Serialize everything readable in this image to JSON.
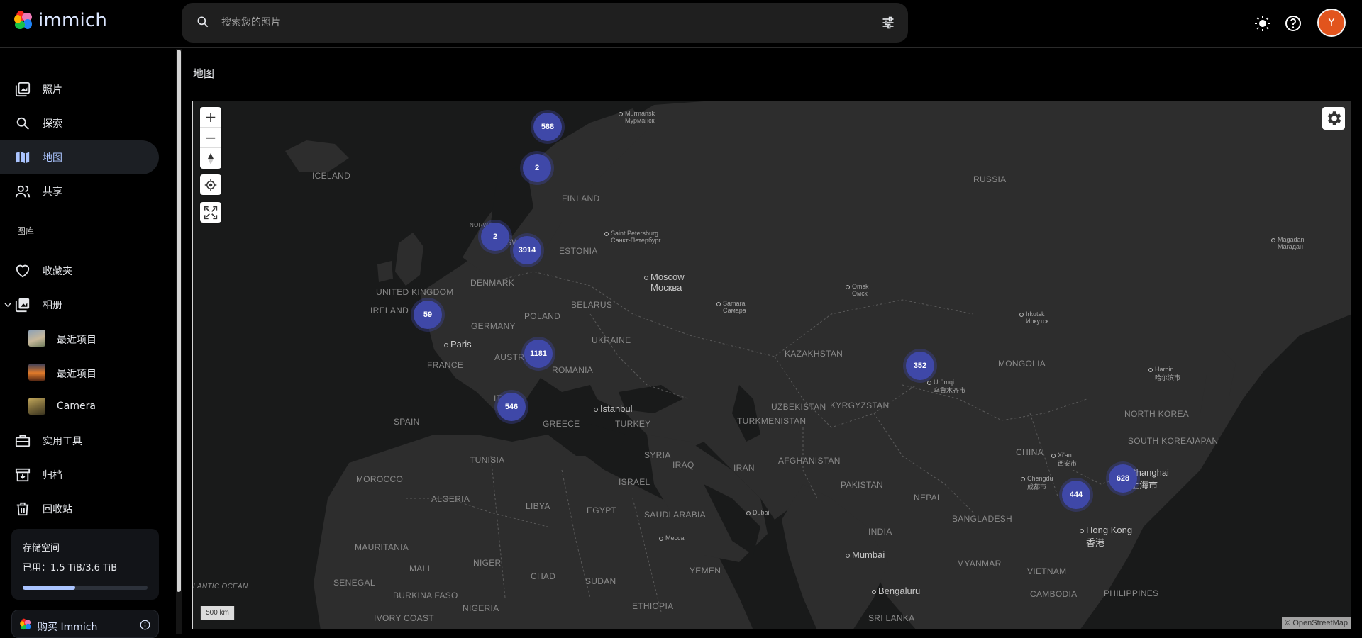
{
  "header": {
    "app_name": "immich",
    "search_placeholder": "搜索您的照片",
    "avatar_initial": "Y",
    "icons": [
      "search-icon",
      "tune-icon",
      "theme-toggle-icon",
      "help-icon"
    ]
  },
  "sidebar": {
    "items": [
      {
        "label": "照片",
        "icon": "photos-icon"
      },
      {
        "label": "探索",
        "icon": "search-icon"
      },
      {
        "label": "地图",
        "icon": "map-icon",
        "active": true
      },
      {
        "label": "共享",
        "icon": "people-icon"
      }
    ],
    "library_section": "图库",
    "library_items": [
      {
        "label": "收藏夹",
        "icon": "heart-icon"
      },
      {
        "label": "相册",
        "icon": "album-icon",
        "expanded": true
      }
    ],
    "albums": [
      {
        "label": "最近项目"
      },
      {
        "label": "最近项目"
      },
      {
        "label": "Camera"
      }
    ],
    "tools": [
      {
        "label": "实用工具",
        "icon": "toolbox-icon"
      },
      {
        "label": "归档",
        "icon": "archive-icon"
      },
      {
        "label": "回收站",
        "icon": "trash-icon"
      }
    ],
    "storage": {
      "title": "存储空间",
      "usage": "已用：1.5 TiB/3.6 TiB",
      "used_fraction": 0.42
    },
    "buy_label": "购买 Immich"
  },
  "main": {
    "title": "地图"
  },
  "map": {
    "scale_label": "500 km",
    "attribution": "© OpenStreetMap",
    "accent": "#3f48a8",
    "clusters": [
      {
        "count": "588"
      },
      {
        "count": "2"
      },
      {
        "count": "2"
      },
      {
        "count": "3914"
      },
      {
        "count": "59"
      },
      {
        "count": "1181"
      },
      {
        "count": "546"
      },
      {
        "count": "352"
      },
      {
        "count": "628"
      },
      {
        "count": "444"
      }
    ],
    "countries": [
      "ICELAND",
      "FINLAND",
      "RUSSIA",
      "NORWAY",
      "SWE",
      "ESTONIA",
      "UNITED KINGDOM",
      "DENMARK",
      "IRELAND",
      "BELARUS",
      "POLAND",
      "GERMANY",
      "UKRAINE",
      "FRANCE",
      "AUSTR",
      "ROMANIA",
      "KAZAKHSTAN",
      "MONGOLIA",
      "ITA",
      "SPAIN",
      "GREECE",
      "TURKEY",
      "UZBEKISTAN",
      "KYRGYZSTAN",
      "TURKMENISTAN",
      "NORTH KOREA",
      "SOUTH KOREA",
      "JAPAN",
      "TUNISIA",
      "SYRIA",
      "IRAQ",
      "IRAN",
      "AFGHANISTAN",
      "CHINA",
      "ISRAEL",
      "MOROCCO",
      "PAKISTAN",
      "ALGERIA",
      "LIBYA",
      "EGYPT",
      "SAUDI ARABIA",
      "NEPAL",
      "BANGLADESH",
      "INDIA",
      "MAURITANIA",
      "NIGER",
      "MALI",
      "CHAD",
      "SUDAN",
      "YEMEN",
      "MYANMAR",
      "VIETNAM",
      "SENEGAL",
      "BURKINA FASO",
      "CAMBODIA",
      "PHILIPPINES",
      "NIGERIA",
      "ETHIOPIA",
      "IVORY COAST",
      "SRI LANKA",
      "LANTIC OCEAN"
    ],
    "cities": [
      {
        "name": "Murmansk",
        "name2": "Мурманск"
      },
      {
        "name": "Saint Petersburg",
        "name2": "Санкт-Петербург"
      },
      {
        "name": "Moscow",
        "name2": "Москва"
      },
      {
        "name": "Omsk",
        "name2": "Омск"
      },
      {
        "name": "Samara",
        "name2": "Самара"
      },
      {
        "name": "Irkutsk",
        "name2": "Иркутск"
      },
      {
        "name": "Magadan",
        "name2": "Магадан"
      },
      {
        "name": "Paris",
        "name2": ""
      },
      {
        "name": "Harbin",
        "name2": "哈尔滨市"
      },
      {
        "name": "Ürümqi",
        "name2": "乌鲁木齐市"
      },
      {
        "name": "Istanbul",
        "name2": ""
      },
      {
        "name": "Xi'an",
        "name2": "西安市"
      },
      {
        "name": "Chengdu",
        "name2": "成都市"
      },
      {
        "name": "Shanghai",
        "name2": "上海市"
      },
      {
        "name": "Dubai",
        "name2": ""
      },
      {
        "name": "Mecca",
        "name2": ""
      },
      {
        "name": "Mumbai",
        "name2": ""
      },
      {
        "name": "Hong Kong",
        "name2": "香港"
      },
      {
        "name": "Bengaluru",
        "name2": ""
      }
    ]
  }
}
